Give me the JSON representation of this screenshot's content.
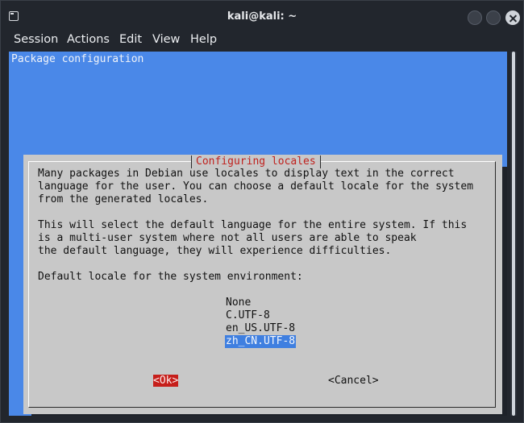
{
  "window": {
    "title": "kali@kali: ~",
    "menu": [
      "Session",
      "Actions",
      "Edit",
      "View",
      "Help"
    ]
  },
  "terminal": {
    "backtitle": "Package configuration"
  },
  "dialog": {
    "title": "Configuring locales",
    "paragraph1": [
      "Many packages in Debian use locales to display text in the correct",
      "language for the user. You can choose a default locale for the system",
      "from the generated locales."
    ],
    "paragraph2": [
      "This will select the default language for the entire system. If this",
      "is a multi-user system where not all users are able to speak",
      "the default language, they will experience difficulties."
    ],
    "prompt": "Default locale for the system environment:",
    "options": [
      "None",
      "C.UTF-8",
      "en_US.UTF-8",
      "zh_CN.UTF-8"
    ],
    "selected_option": "zh_CN.UTF-8",
    "ok_label": "Ok",
    "cancel_label": "Cancel"
  },
  "colors": {
    "terminal_bg": "#4a88e8",
    "dialog_bg": "#c8c8c8",
    "title_red": "#c0211d",
    "ok_highlight": "#c61f1b",
    "selection": "#3f7fe0"
  }
}
